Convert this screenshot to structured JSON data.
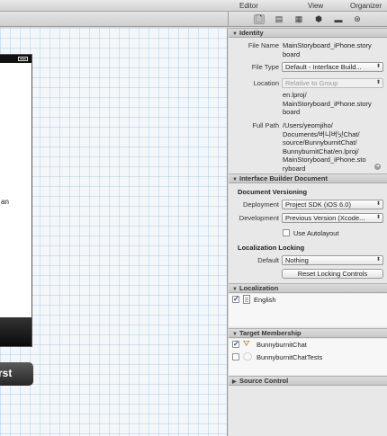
{
  "toolbar": {
    "editor": "Editor",
    "view": "View",
    "organizer": "Organizer"
  },
  "inspector_tabs": [
    {
      "icon": "file-inspector-icon",
      "glyph": "🗋"
    },
    {
      "icon": "quick-help-icon",
      "glyph": "▤"
    },
    {
      "icon": "identity-inspector-icon",
      "glyph": "▦"
    },
    {
      "icon": "attributes-inspector-icon",
      "glyph": "⬢"
    },
    {
      "icon": "size-inspector-icon",
      "glyph": "▬"
    },
    {
      "icon": "connections-inspector-icon",
      "glyph": "⊛"
    }
  ],
  "canvas": {
    "partial_label": "an",
    "partial_button": "rst"
  },
  "identity": {
    "header": "Identity",
    "file_name_label": "File Name",
    "file_name": "MainStoryboard_iPhone.storyboard",
    "file_name_line1": "MainStoryboard_iPhone.story",
    "file_name_line2": "board",
    "file_type_label": "File Type",
    "file_type": "Default - Interface Build...",
    "location_label": "Location",
    "location": "Relative to Group",
    "location_path_lines": [
      "en.lproj/",
      "MainStoryboard_iPhone.story",
      "board"
    ],
    "full_path_label": "Full Path",
    "full_path_lines": [
      "/Users/yeomjiho/",
      "Documents/버니버닛Chat/",
      "source/BunnyburnitChat/",
      "BunnyburnitChat/en.lproj/",
      "MainStoryboard_iPhone.sto",
      "ryboard"
    ]
  },
  "ib_document": {
    "header": "Interface Builder Document",
    "versioning_label": "Document Versioning",
    "deployment_label": "Deployment",
    "deployment": "Project SDK (iOS 6.0)",
    "development_label": "Development",
    "development": "Previous Version (Xcode...",
    "autolayout_label": "Use Autolayout",
    "autolayout_checked": false,
    "loc_locking_label": "Localization Locking",
    "default_label": "Default",
    "default_value": "Nothing",
    "reset_button": "Reset Locking Controls"
  },
  "localization": {
    "header": "Localization",
    "items": [
      {
        "label": "English",
        "checked": true
      }
    ]
  },
  "target_membership": {
    "header": "Target Membership",
    "items": [
      {
        "label": "BunnyburnitChat",
        "checked": true,
        "icon": "app-target-icon"
      },
      {
        "label": "BunnyburnitChatTests",
        "checked": false,
        "icon": "test-target-icon"
      }
    ]
  },
  "source_control": {
    "header": "Source Control"
  },
  "colors": {
    "canvas_bg": "#f3f7fa",
    "grid": "#96b9d7",
    "inspector_bg": "#e8e8e8",
    "checkmark": "#1a3f8f"
  }
}
